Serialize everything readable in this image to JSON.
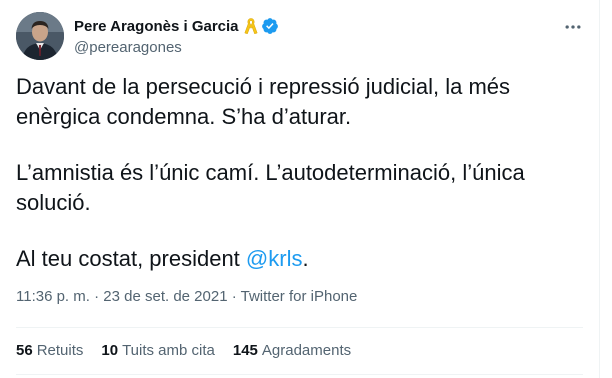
{
  "author": {
    "display_name": "Pere Aragonès i Garcia",
    "handle": "@perearagones",
    "badge_icon": "yellow-ribbon-icon",
    "verified_icon": "verified-badge-icon",
    "verified_color": "#1d9bf0",
    "ribbon_color": "#f5c518"
  },
  "tweet": {
    "paragraph_1": "Davant de la persecució i repressió judicial, la més enèrgica condemna. S’ha d’aturar.",
    "paragraph_2": "L’amnistia és l’únic camí. L’autodeterminació, l’única solució.",
    "paragraph_3_text": "Al teu costat, president ",
    "paragraph_3_mention": "@krls",
    "paragraph_3_end": ".",
    "mention_color": "#1d9bf0"
  },
  "meta": {
    "time": "11:36 p. m.",
    "separator": " · ",
    "date": "23 de set. de 2021",
    "separator_2": " · ",
    "source": "Twitter for iPhone"
  },
  "stats": {
    "retweets_count": "56",
    "retweets_label": "Retuits",
    "quotes_count": "10",
    "quotes_label": "Tuits amb cita",
    "likes_count": "145",
    "likes_label": "Agradaments"
  },
  "icons": {
    "more": "more-options-icon"
  }
}
